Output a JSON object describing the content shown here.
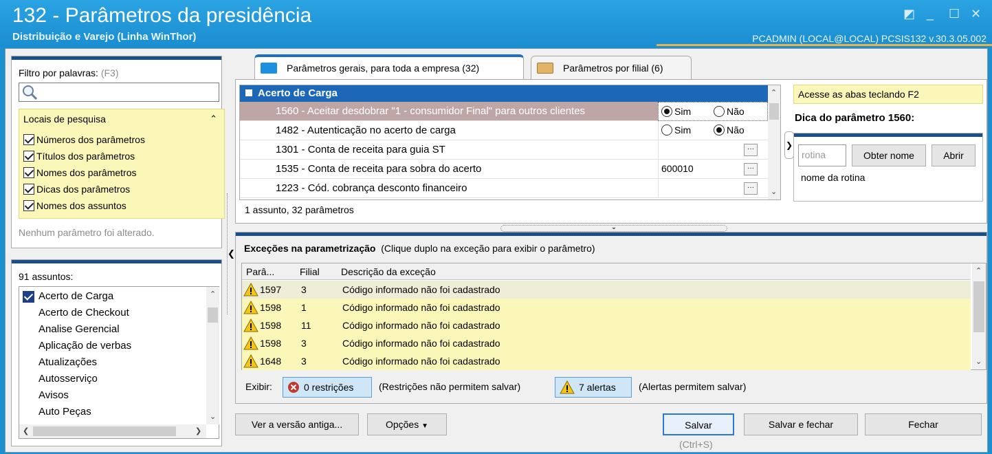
{
  "window": {
    "title": "132 - Parâmetros da presidência",
    "subtitle": "Distribuição e Varejo (Linha WinThor)",
    "user_info": "PCADMIN (LOCAL@LOCAL)   PCSIS132  v.30.3.05.002"
  },
  "filter": {
    "label": "Filtro por palavras:",
    "shortcut": "(F3)",
    "search_value": "",
    "locais": {
      "title": "Locais de pesquisa",
      "options": [
        {
          "label": "Números dos parâmetros",
          "checked": true
        },
        {
          "label": "Títulos dos parâmetros",
          "checked": true
        },
        {
          "label": "Nomes dos parâmetros",
          "checked": true
        },
        {
          "label": "Dicas dos parâmetros",
          "checked": true
        },
        {
          "label": "Nomes dos assuntos",
          "checked": true
        }
      ]
    },
    "status": "Nenhum parâmetro foi alterado."
  },
  "subjects": {
    "count_label": "91 assuntos:",
    "items": [
      "Acerto de Carga",
      "Acerto de Checkout",
      "Analise Gerencial",
      "Aplicação de verbas",
      "Atualizações",
      "Autosserviço",
      "Avisos",
      "Auto Peças"
    ],
    "selected": "Acerto de Carga"
  },
  "tabs": [
    {
      "label": "Parâmetros gerais, para toda a empresa (32)",
      "active": true
    },
    {
      "label": "Parâmetros por filial (6)",
      "active": false
    }
  ],
  "params": {
    "group": "Acerto de Carga",
    "rows": [
      {
        "name": "1560 - Aceitar desdobrar \"1 - consumidor Final\" para outros clientes",
        "type": "radio",
        "value": "Sim"
      },
      {
        "name": "1482 - Autenticação no acerto de carga",
        "type": "radio",
        "value": "Não"
      },
      {
        "name": "1301 - Conta de receita para guia ST",
        "type": "lookup",
        "value": ""
      },
      {
        "name": "1535 - Conta de receita para sobra do acerto",
        "type": "lookup",
        "value": "600010"
      },
      {
        "name": "1223 - Cód. cobrança desconto financeiro",
        "type": "lookup",
        "value": ""
      }
    ],
    "radio_yes": "Sim",
    "radio_no": "Não",
    "status": "1 assunto, 32 parâmetros"
  },
  "tip": {
    "hint": "Acesse as abas teclando F2",
    "title": "Dica do parâmetro 1560:",
    "rotina_placeholder": "rotina",
    "btn_get_name": "Obter nome",
    "btn_open": "Abrir",
    "desc": "nome da rotina"
  },
  "exceptions": {
    "title": "Exceções na parametrização",
    "subtitle": "(Clique duplo na exceção para exibir o parâmetro)",
    "headers": {
      "param": "Parâ...",
      "filial": "Filial",
      "desc": "Descrição da exceção"
    },
    "rows": [
      {
        "param": "1597",
        "filial": "3",
        "desc": "Código informado não foi cadastrado"
      },
      {
        "param": "1598",
        "filial": "1",
        "desc": "Código informado não foi cadastrado"
      },
      {
        "param": "1598",
        "filial": "11",
        "desc": "Código informado não foi cadastrado"
      },
      {
        "param": "1598",
        "filial": "3",
        "desc": "Código informado não foi cadastrado"
      },
      {
        "param": "1648",
        "filial": "3",
        "desc": "Código informado não foi cadastrado"
      }
    ],
    "exibir": "Exibir:",
    "restricoes": "0 restrições",
    "restricoes_note": "(Restrições não permitem salvar)",
    "alertas": "7 alertas",
    "alertas_note": "(Alertas permitem salvar)"
  },
  "buttons": {
    "old_version": "Ver a versão antiga...",
    "options": "Opções",
    "save": "Salvar",
    "save_shortcut": "(Ctrl+S)",
    "save_close": "Salvar e fechar",
    "close": "Fechar"
  }
}
